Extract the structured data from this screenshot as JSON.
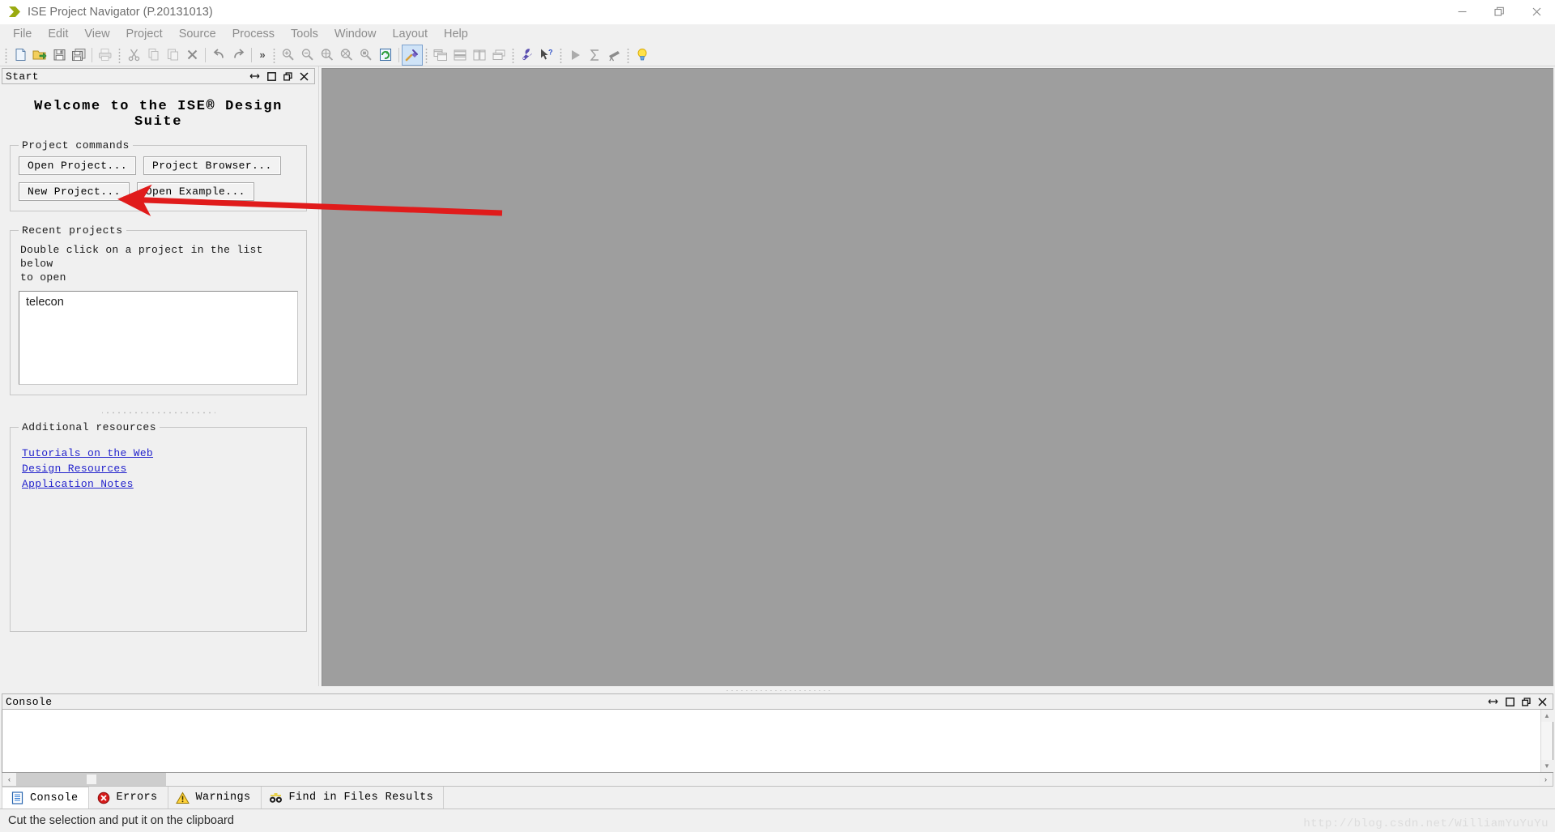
{
  "window": {
    "title": "ISE Project Navigator (P.20131013)",
    "app_icon": "ise-arrow-icon",
    "minimize_label": "Minimize",
    "restore_label": "Restore",
    "close_label": "Close"
  },
  "menubar": {
    "items": [
      {
        "label": "File"
      },
      {
        "label": "Edit"
      },
      {
        "label": "View"
      },
      {
        "label": "Project"
      },
      {
        "label": "Source"
      },
      {
        "label": "Process"
      },
      {
        "label": "Tools"
      },
      {
        "label": "Window"
      },
      {
        "label": "Layout"
      },
      {
        "label": "Help"
      }
    ]
  },
  "toolbar": {
    "overflow_label": "»",
    "groups": [
      {
        "name": "file-group",
        "buttons": [
          {
            "icon": "new-file-icon",
            "tooltip": "New"
          },
          {
            "icon": "open-folder-icon",
            "tooltip": "Open"
          },
          {
            "icon": "save-icon",
            "tooltip": "Save"
          },
          {
            "icon": "save-all-icon",
            "tooltip": "Save All"
          },
          {
            "icon": "print-icon",
            "tooltip": "Print"
          }
        ]
      },
      {
        "name": "edit-group",
        "buttons": [
          {
            "icon": "cut-icon",
            "tooltip": "Cut"
          },
          {
            "icon": "copy-icon",
            "tooltip": "Copy"
          },
          {
            "icon": "paste-icon",
            "tooltip": "Paste"
          },
          {
            "icon": "delete-icon",
            "tooltip": "Delete"
          },
          {
            "icon": "undo-icon",
            "tooltip": "Undo"
          },
          {
            "icon": "redo-icon",
            "tooltip": "Redo"
          }
        ]
      },
      {
        "name": "zoom-group",
        "buttons": [
          {
            "icon": "zoom-in-icon",
            "tooltip": "Zoom In"
          },
          {
            "icon": "zoom-out-icon",
            "tooltip": "Zoom Out"
          },
          {
            "icon": "zoom-fit-icon",
            "tooltip": "Zoom To Fit"
          },
          {
            "icon": "zoom-area-icon",
            "tooltip": "Zoom Area"
          },
          {
            "icon": "zoom-select-icon",
            "tooltip": "Zoom Selection"
          },
          {
            "icon": "refresh-icon",
            "tooltip": "Refresh"
          },
          {
            "icon": "design-goals-icon",
            "tooltip": "Design Goals & Strategies",
            "active": true
          }
        ]
      },
      {
        "name": "window-layout-group",
        "buttons": [
          {
            "icon": "cascade-windows-icon",
            "tooltip": "Cascade"
          },
          {
            "icon": "tile-horizontally-icon",
            "tooltip": "Tile Horizontally"
          },
          {
            "icon": "tile-vertically-icon",
            "tooltip": "Tile Vertically"
          },
          {
            "icon": "restore-window-icon",
            "tooltip": "Restore"
          }
        ]
      },
      {
        "name": "help-group",
        "buttons": [
          {
            "icon": "wrench-icon",
            "tooltip": "Preferences"
          },
          {
            "icon": "context-help-icon",
            "tooltip": "Context Help"
          }
        ]
      },
      {
        "name": "run-group",
        "buttons": [
          {
            "icon": "run-icon",
            "tooltip": "Run"
          },
          {
            "icon": "sigma-icon",
            "tooltip": "Summary"
          },
          {
            "icon": "telescope-icon",
            "tooltip": "Explore"
          }
        ]
      },
      {
        "name": "tips-group",
        "buttons": [
          {
            "icon": "lightbulb-icon",
            "tooltip": "Tip of the Day"
          }
        ]
      }
    ]
  },
  "start_panel": {
    "title": "Start",
    "header_buttons": [
      {
        "icon": "float-arrows-icon",
        "name": "float-panel-button"
      },
      {
        "icon": "maximize-square-icon",
        "name": "maximize-panel-button"
      },
      {
        "icon": "restore-panel-icon",
        "name": "restore-panel-button"
      },
      {
        "icon": "close-x-icon",
        "name": "close-panel-button"
      }
    ],
    "welcome": "Welcome to the ISE® Design Suite",
    "project_commands": {
      "legend": "Project commands",
      "buttons": [
        {
          "label": "Open Project..."
        },
        {
          "label": "Project Browser..."
        },
        {
          "label": "New Project..."
        },
        {
          "label": "Open Example..."
        }
      ]
    },
    "recent_projects": {
      "legend": "Recent projects",
      "help_line1": "Double click on a project in the list below",
      "help_line2": "to open",
      "items": [
        "telecon"
      ]
    },
    "additional_resources": {
      "legend": "Additional resources",
      "links": [
        {
          "label": "Tutorials on the Web"
        },
        {
          "label": "Design Resources"
        },
        {
          "label": "Application Notes"
        }
      ]
    }
  },
  "console_panel": {
    "title": "Console",
    "content": "",
    "header_buttons": [
      {
        "icon": "float-arrows-icon",
        "name": "float-console-button"
      },
      {
        "icon": "maximize-square-icon",
        "name": "maximize-console-button"
      },
      {
        "icon": "restore-panel-icon",
        "name": "restore-console-button"
      },
      {
        "icon": "close-x-icon",
        "name": "close-console-button"
      }
    ],
    "scroll_left_label": "‹",
    "scroll_right_label": "›",
    "scroll_up_label": "▲",
    "scroll_down_label": "▼"
  },
  "bottom_tabs": [
    {
      "label": "Console",
      "icon": "console-document-icon",
      "selected": true
    },
    {
      "label": "Errors",
      "icon": "error-circle-icon",
      "selected": false
    },
    {
      "label": "Warnings",
      "icon": "warning-triangle-icon",
      "selected": false
    },
    {
      "label": "Find in Files Results",
      "icon": "binoculars-icon",
      "selected": false
    }
  ],
  "statusbar": {
    "message": "Cut the selection and put it on the clipboard",
    "watermark": "http://blog.csdn.net/WilliamYuYuYu"
  },
  "annotation": {
    "type": "red-arrow",
    "color": "#e01b1b",
    "points_to": "New Project..."
  },
  "colors": {
    "window_bg": "#f0f0f0",
    "workspace_bg": "#9e9e9e",
    "link": "#2222cc",
    "accent_selected": "#cfe3f7",
    "arrow_red": "#e01b1b"
  }
}
